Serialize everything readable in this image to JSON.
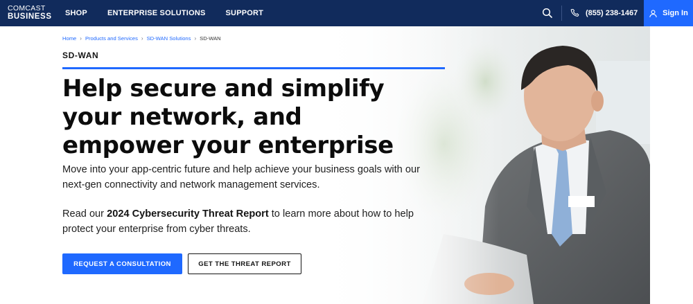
{
  "nav": {
    "logo_line1": "COMCAST",
    "logo_line2": "BUSINESS",
    "links": [
      "SHOP",
      "ENTERPRISE SOLUTIONS",
      "SUPPORT"
    ],
    "search_icon": "search-icon",
    "phone_icon": "phone-icon",
    "phone": "(855) 238-1467",
    "signin_icon": "user-icon",
    "signin": "Sign In"
  },
  "breadcrumb": {
    "items": [
      "Home",
      "Products and Services",
      "SD-WAN Solutions"
    ],
    "current": "SD-WAN"
  },
  "hero": {
    "eyebrow": "SD-WAN",
    "headline_lines": [
      "Help secure and simplify",
      "your network, and",
      "empower your enterprise"
    ],
    "body": "Move into your app-centric future and help achieve your business goals with our next-gen connectivity and network management services.",
    "body2_prefix": "Read our ",
    "body2_strong": "2024 Cybersecurity Threat Report",
    "body2_suffix": " to learn more about how to help protect your enterprise from cyber threats.",
    "primary_button": "REQUEST A CONSULTATION",
    "secondary_button": "GET THE THREAT REPORT"
  },
  "colors": {
    "nav_bg": "#112b5c",
    "accent": "#1f69ff",
    "text": "#141414"
  }
}
